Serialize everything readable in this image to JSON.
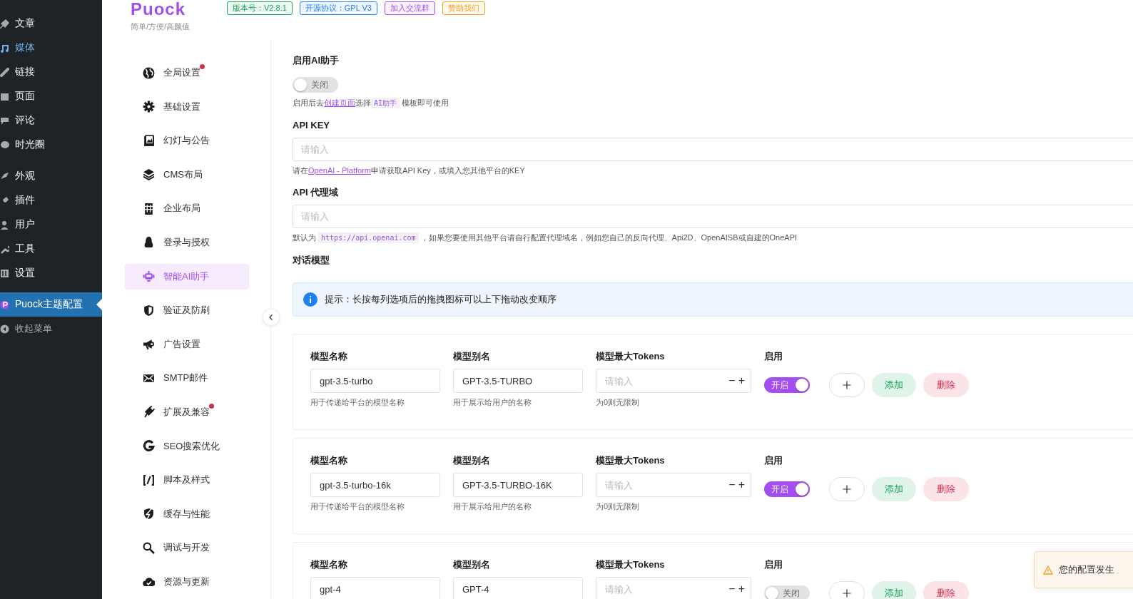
{
  "wp_menu": [
    {
      "label": "文章",
      "selected": false
    },
    {
      "label": "媒体",
      "selected": false,
      "hover": true
    },
    {
      "label": "链接",
      "selected": false
    },
    {
      "label": "页面",
      "selected": false
    },
    {
      "label": "评论",
      "selected": false
    },
    {
      "label": "时光圈",
      "selected": false
    },
    {
      "kind": "separator"
    },
    {
      "label": "外观",
      "selected": false
    },
    {
      "label": "插件",
      "selected": false
    },
    {
      "label": "用户",
      "selected": false
    },
    {
      "label": "工具",
      "selected": false
    },
    {
      "label": "设置",
      "selected": false
    },
    {
      "kind": "separator"
    },
    {
      "label": "Puock主题配置",
      "selected": true
    },
    {
      "label": "收起菜单",
      "selected": false,
      "kind": "collapse"
    }
  ],
  "header": {
    "logo": "Puock",
    "tagline": "简单/方便/高颜值",
    "badges": [
      {
        "label": "版本号：V2.8.1",
        "color": "#18a058"
      },
      {
        "label": "开源协议：GPL V3",
        "color": "#2080f0"
      },
      {
        "label": "加入交流群",
        "color": "#a34ff0"
      },
      {
        "label": "赞助我们",
        "color": "#f0a020"
      }
    ]
  },
  "settings_nav": [
    {
      "label": "全局设置",
      "selected": false,
      "dot": true
    },
    {
      "label": "基础设置",
      "selected": false,
      "dot": false
    },
    {
      "label": "幻灯与公告",
      "selected": false,
      "dot": false
    },
    {
      "label": "CMS布局",
      "selected": false,
      "dot": false
    },
    {
      "label": "企业布局",
      "selected": false,
      "dot": false
    },
    {
      "label": "登录与授权",
      "selected": false,
      "dot": false
    },
    {
      "label": "智能AI助手",
      "selected": true,
      "dot": false
    },
    {
      "label": "验证及防刷",
      "selected": false,
      "dot": false
    },
    {
      "label": "广告设置",
      "selected": false,
      "dot": false
    },
    {
      "label": "SMTP邮件",
      "selected": false,
      "dot": false
    },
    {
      "label": "扩展及兼容",
      "selected": false,
      "dot": true
    },
    {
      "label": "SEO搜索优化",
      "selected": false,
      "dot": false
    },
    {
      "label": "脚本及样式",
      "selected": false,
      "dot": false
    },
    {
      "label": "缓存与性能",
      "selected": false,
      "dot": false
    },
    {
      "label": "调试与开发",
      "selected": false,
      "dot": false
    },
    {
      "label": "资源与更新",
      "selected": false,
      "dot": false
    }
  ],
  "enable_ai": {
    "label": "启用AI助手",
    "on": false,
    "toggle_text": "关闭",
    "hint": {
      "before": "启用后去",
      "link": "创建页面",
      "middle": "选择",
      "code": "AI助手",
      "after": " 模板即可使用"
    }
  },
  "api_key": {
    "label": "API KEY",
    "placeholder": "请输入",
    "hint": {
      "before": "请在",
      "link": "OpenAI - Platform",
      "after": "申请获取API Key，或填入您其他平台的KEY"
    }
  },
  "api_proxy": {
    "label": "API 代理域",
    "placeholder": "请输入",
    "hint": {
      "before": "默认为 ",
      "code": "https://api.openai.com",
      "after": " ，如果您要使用其他平台请自行配置代理域名，例如您自己的反向代理、Api2D、OpenAISB或自建的OneAPI"
    }
  },
  "models_section": {
    "label": "对话模型",
    "tip": "提示：长按每列选项后的拖拽图标可以上下拖动改变顺序"
  },
  "models": [
    {
      "name_label": "模型名称",
      "name": "gpt-3.5-turbo",
      "name_hint": "用于传递给平台的模型名称",
      "alias_label": "模型别名",
      "alias": "GPT-3.5-TURBO",
      "alias_hint": "用于展示给用户的名称",
      "tokens_label": "模型最大Tokens",
      "tokens_placeholder": "请输入",
      "tokens_hint": "为0则无限制",
      "minus": "−",
      "plus": "+",
      "enabled_label": "启用",
      "on": true,
      "toggle_text": "开启",
      "add": "添加",
      "delete": "删除"
    },
    {
      "name_label": "模型名称",
      "name": "gpt-3.5-turbo-16k",
      "name_hint": "用于传递给平台的模型名称",
      "alias_label": "模型别名",
      "alias": "GPT-3.5-TURBO-16K",
      "alias_hint": "用于展示给用户的名称",
      "tokens_label": "模型最大Tokens",
      "tokens_placeholder": "请输入",
      "tokens_hint": "为0则无限制",
      "minus": "−",
      "plus": "+",
      "enabled_label": "启用",
      "on": true,
      "toggle_text": "开启",
      "add": "添加",
      "delete": "删除"
    },
    {
      "name_label": "模型名称",
      "name": "gpt-4",
      "alias_label": "模型别名",
      "alias": "GPT-4",
      "tokens_label": "模型最大Tokens",
      "tokens_placeholder": "请输入",
      "minus": "−",
      "plus": "+",
      "enabled_label": "启用",
      "on": false,
      "toggle_text": "关闭",
      "add": "添加",
      "delete": "删除"
    }
  ],
  "toast": {
    "text": "您的配置发生"
  }
}
